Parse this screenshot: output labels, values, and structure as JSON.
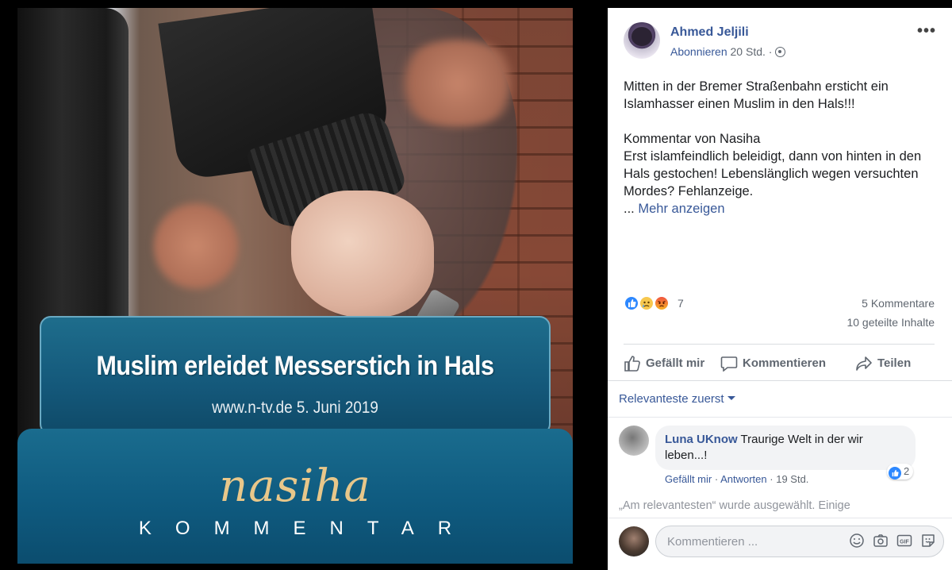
{
  "image": {
    "banner_title": "Muslim erleidet Messerstich in Hals",
    "banner_source": "www.n-tv.de  5. Juni 2019",
    "brand_name": "nasiha",
    "brand_subtitle": "KOMMENTAR"
  },
  "post": {
    "author": "Ahmed Jeljili",
    "follow_label": "Abonnieren",
    "separator": " · ",
    "time": "20 Std.",
    "more_label": "•••",
    "text": "Mitten in der Bremer Straßenbahn ersticht ein Islamhasser einen Muslim in den Hals!!!\n\nKommentar von Nasiha\nErst islamfeindlich beleidigt, dann von hinten in den Hals gestochen! Lebenslänglich wegen versuchten Mordes? Fehlanzeige.",
    "ellipsis": "... ",
    "see_more": "Mehr anzeigen"
  },
  "reactions": {
    "count": "7",
    "comments": "5 Kommentare",
    "shares": "10 geteilte Inhalte"
  },
  "actions": {
    "like": "Gefällt mir",
    "comment": "Kommentieren",
    "share": "Teilen"
  },
  "sort": {
    "label": "Relevanteste zuerst"
  },
  "comment": {
    "author": "Luna UKnow",
    "text": " Traurige Welt in der wir leben...!",
    "reaction_count": "2",
    "like": "Gefällt mir",
    "reply": "Antworten",
    "time": "19 Std."
  },
  "notice": "„Am relevantesten“ wurde ausgewählt. Einige",
  "compose": {
    "placeholder": "Kommentieren ..."
  },
  "colors": {
    "link": "#385898",
    "meta": "#606770",
    "like_blue": "#2d88ff"
  }
}
